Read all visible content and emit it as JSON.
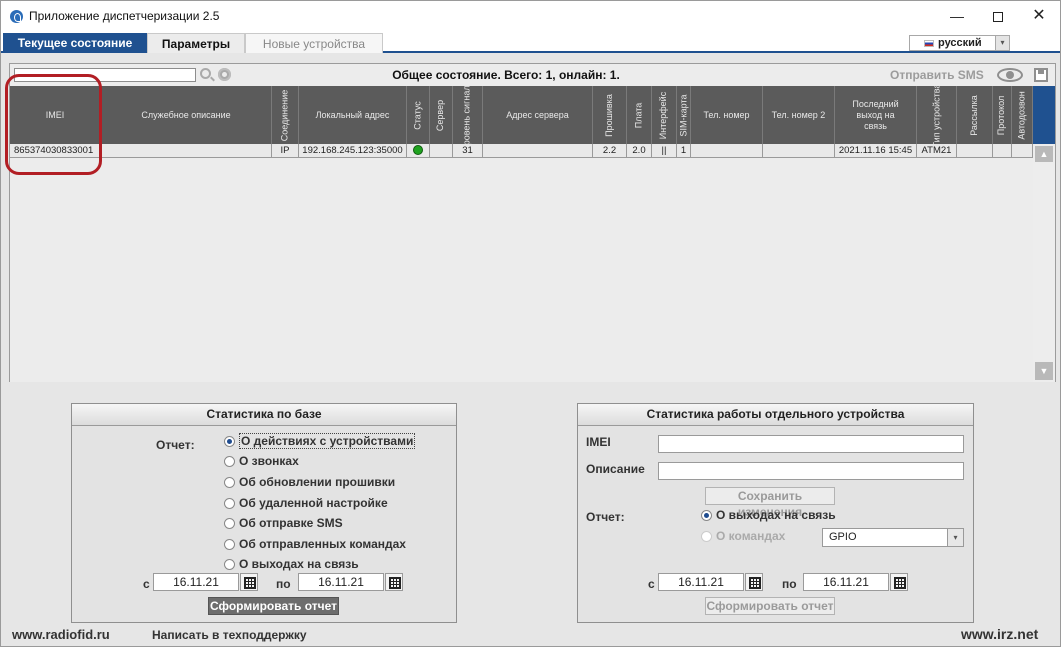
{
  "window": {
    "title": "Приложение диспетчеризации 2.5",
    "minimize": "—",
    "close": "✕"
  },
  "tabs": [
    {
      "label": "Текущее состояние",
      "active": true
    },
    {
      "label": "Параметры",
      "active": false
    },
    {
      "label": "Новые устройства",
      "active": false
    }
  ],
  "language": {
    "selected": "русский",
    "arrow": "▾"
  },
  "grid": {
    "filter_value": "",
    "overall_status": "Общее состояние. Всего: 1, онлайн: 1.",
    "send_sms_label": "Отправить SMS",
    "columns": [
      {
        "label": "IMEI"
      },
      {
        "label": "Служебное описание"
      },
      {
        "label": "Соединение"
      },
      {
        "label": "Локальный адрес"
      },
      {
        "label": "Статус"
      },
      {
        "label": "Сервер"
      },
      {
        "label": "Уровень сигнала"
      },
      {
        "label": "Адрес сервера"
      },
      {
        "label": "Прошивка"
      },
      {
        "label": "Плата"
      },
      {
        "label": "Интерфейс"
      },
      {
        "label": "SIM-карта"
      },
      {
        "label": "Тел. номер"
      },
      {
        "label": "Тел. номер 2"
      },
      {
        "label": "Последний выход на связь"
      },
      {
        "label": "Тип устройства"
      },
      {
        "label": "Рассылка"
      },
      {
        "label": "Протокол"
      },
      {
        "label": "Автодозвон"
      }
    ],
    "rows": [
      {
        "imei": "865374030833001",
        "description": "",
        "connection": "IP",
        "local_address": "192.168.245.123:35000",
        "status": "online",
        "server": "",
        "signal": "31",
        "server_address": "",
        "firmware": "2.2",
        "board": "2.0",
        "interface": "||",
        "sim": "1",
        "phone": "",
        "phone2": "",
        "last_seen": "2021.11.16 15:45",
        "device_type": "ATM21",
        "mailing": "",
        "protocol": "",
        "autodial": ""
      }
    ],
    "scroll_up": "▲",
    "scroll_down": "▼"
  },
  "db_stats": {
    "title": "Статистика по базе",
    "report_label": "Отчет:",
    "options": [
      {
        "label": "О действиях с устройствами",
        "checked": true
      },
      {
        "label": "О звонках",
        "checked": false
      },
      {
        "label": "Об обновлении прошивки",
        "checked": false
      },
      {
        "label": "Об удаленной настройке",
        "checked": false
      },
      {
        "label": "Об отправке SMS",
        "checked": false
      },
      {
        "label": "Об отправленных командах",
        "checked": false
      },
      {
        "label": "О выходах на связь",
        "checked": false
      }
    ],
    "from_label": "с",
    "from_date": "16.11.21",
    "to_label": "по",
    "to_date": "16.11.21",
    "generate_button": "Сформировать отчет"
  },
  "device_stats": {
    "title": "Статистика работы отдельного устройства",
    "imei_label": "IMEI",
    "imei_value": "",
    "description_label": "Описание",
    "description_value": "",
    "save_button": "Сохранить изменения",
    "report_label": "Отчет:",
    "options": [
      {
        "label": "О выходах на связь",
        "checked": true,
        "disabled": false
      },
      {
        "label": "О командах",
        "checked": false,
        "disabled": true
      }
    ],
    "command_select": "GPIO",
    "select_arrow": "▾",
    "from_label": "с",
    "from_date": "16.11.21",
    "to_label": "по",
    "to_date": "16.11.21",
    "generate_button": "Сформировать отчет"
  },
  "footer": {
    "left_link": "www.radiofid.ru",
    "support_link": "Написать в техподдержку",
    "right_link": "www.irz.net"
  },
  "colors": {
    "accent": "#1f5190",
    "header_bg": "#5b5b5b",
    "status_online": "#1fa31f",
    "highlight": "#b21e24"
  }
}
